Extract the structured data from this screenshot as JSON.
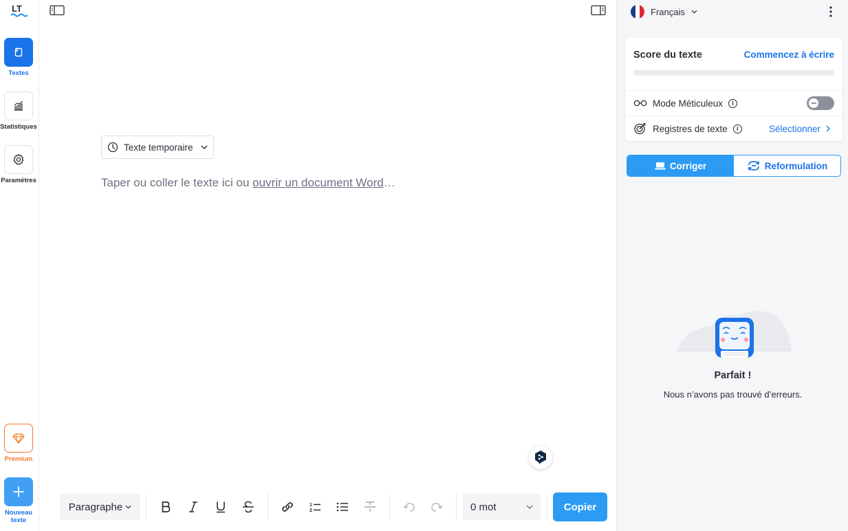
{
  "nav": {
    "texts_label": "Textes",
    "stats_label": "Statistiques",
    "settings_label": "Paramètres",
    "premium_label": "Premium",
    "new_label_1": "Nouveau",
    "new_label_2": "texte"
  },
  "editor": {
    "doc_type": "Texte temporaire",
    "placeholder_pre": "Taper ou coller le texte ici ou ",
    "placeholder_link": "ouvrir un document Word",
    "placeholder_post": "…"
  },
  "toolbar": {
    "paragraph": "Paragraphe",
    "word_count": "0 mot",
    "copy": "Copier"
  },
  "panel": {
    "language": "Français",
    "score_title": "Score du texte",
    "score_link": "Commencez à écrire",
    "picky_mode": "Mode Méticuleux",
    "registers": "Registres de texte",
    "select": "Sélectionner",
    "tab_correct": "Corriger",
    "tab_rephrase": "Reformulation",
    "perfect": "Parfait !",
    "no_errors": "Nous n’avons pas trouvé d’erreurs."
  },
  "colors": {
    "accent": "#2b9bf4",
    "link": "#1a73e8",
    "premium": "#f07c2d"
  }
}
